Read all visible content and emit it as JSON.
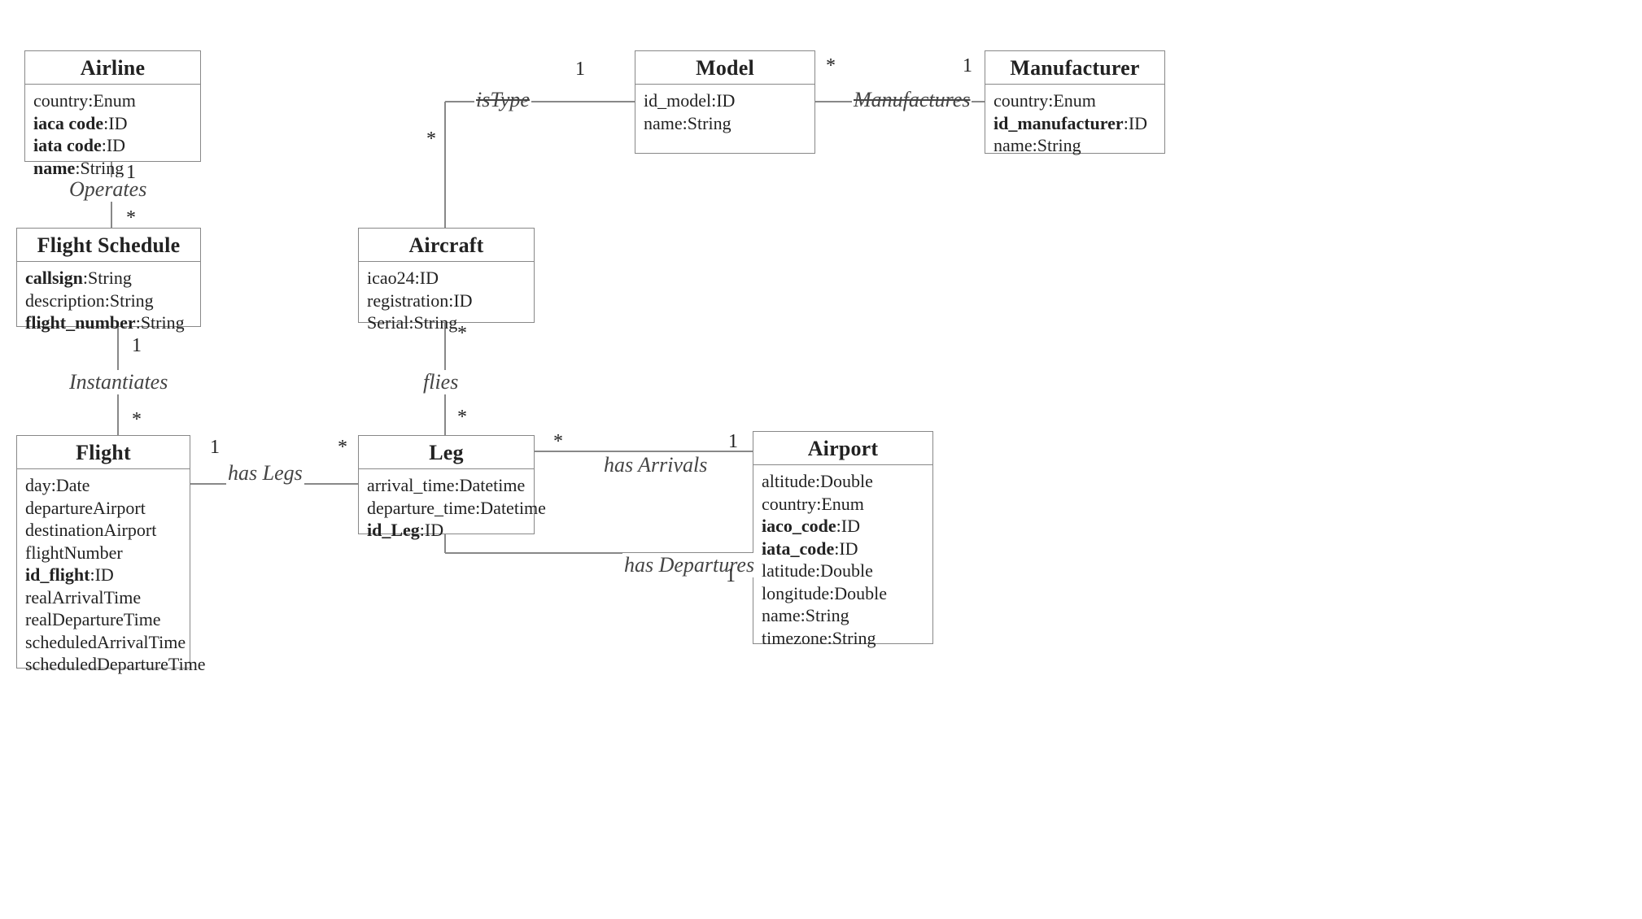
{
  "entities": {
    "airline": {
      "title": "Airline",
      "attrs": [
        {
          "key": "country",
          "type": "Enum",
          "bold": false
        },
        {
          "key": "iaca code",
          "type": "ID",
          "bold": true
        },
        {
          "key": "iata code",
          "type": "ID",
          "bold": true
        },
        {
          "key": "name",
          "type": "String",
          "bold": true
        }
      ]
    },
    "flightSchedule": {
      "title": "Flight Schedule",
      "attrs": [
        {
          "key": "callsign",
          "type": "String",
          "bold": true
        },
        {
          "key": "description",
          "type": "String",
          "bold": false
        },
        {
          "key": "flight_number",
          "type": "String",
          "bold": true
        }
      ]
    },
    "flight": {
      "title": "Flight",
      "attrs": [
        {
          "key": "day",
          "type": "Date",
          "bold": false
        },
        {
          "key": "departureAirport",
          "type": "",
          "bold": false
        },
        {
          "key": "destinationAirport",
          "type": "",
          "bold": false
        },
        {
          "key": "flightNumber",
          "type": "",
          "bold": false
        },
        {
          "key": "id_flight",
          "type": "ID",
          "bold": true
        },
        {
          "key": "realArrivalTime",
          "type": "",
          "bold": false
        },
        {
          "key": "realDepartureTime",
          "type": "",
          "bold": false
        },
        {
          "key": "scheduledArrivalTime",
          "type": "",
          "bold": false
        },
        {
          "key": "scheduledDepartureTime",
          "type": "",
          "bold": false
        }
      ]
    },
    "aircraft": {
      "title": "Aircraft",
      "attrs": [
        {
          "key": "icao24",
          "type": "ID",
          "bold": false
        },
        {
          "key": "registration",
          "type": "ID",
          "bold": false
        },
        {
          "key": "Serial",
          "type": "String",
          "bold": false
        }
      ]
    },
    "leg": {
      "title": "Leg",
      "attrs": [
        {
          "key": "arrival_time",
          "type": "Datetime",
          "bold": false
        },
        {
          "key": "departure_time",
          "type": "Datetime",
          "bold": false
        },
        {
          "key": "id_Leg",
          "type": "ID",
          "bold": true
        }
      ]
    },
    "model": {
      "title": "Model",
      "attrs": [
        {
          "key": "id_model",
          "type": "ID",
          "bold": false
        },
        {
          "key": "name",
          "type": "String",
          "bold": false
        }
      ]
    },
    "manufacturer": {
      "title": "Manufacturer",
      "attrs": [
        {
          "key": "country",
          "type": "Enum",
          "bold": false
        },
        {
          "key": "id_manufacturer",
          "type": "ID",
          "bold": true
        },
        {
          "key": "name",
          "type": "String",
          "bold": false
        }
      ]
    },
    "airport": {
      "title": "Airport",
      "attrs": [
        {
          "key": "altitude",
          "type": "Double",
          "bold": false
        },
        {
          "key": "country",
          "type": "Enum",
          "bold": false
        },
        {
          "key": "iaco_code",
          "type": "ID",
          "bold": true
        },
        {
          "key": "iata_code",
          "type": "ID",
          "bold": true
        },
        {
          "key": "latitude",
          "type": "Double",
          "bold": false
        },
        {
          "key": "longitude",
          "type": "Double",
          "bold": false
        },
        {
          "key": "name",
          "type": "String",
          "bold": false
        },
        {
          "key": "timezone",
          "type": "String",
          "bold": false
        }
      ]
    }
  },
  "relations": {
    "operates": {
      "label": "Operates",
      "m1": "1",
      "m2": "*"
    },
    "instantiates": {
      "label": "Instantiates",
      "m1": "1",
      "m2": "*"
    },
    "hasLegs": {
      "label": "has Legs",
      "m1": "1",
      "m2": "*"
    },
    "flies": {
      "label": "flies",
      "m1": "*",
      "m2": "*"
    },
    "isType": {
      "label": "isType",
      "m1": "*",
      "m2": "1"
    },
    "manufactures": {
      "label": "Manufactures",
      "m1": "*",
      "m2": "1"
    },
    "hasArrivals": {
      "label": "has Arrivals",
      "m1": "*",
      "m2": "1"
    },
    "hasDepartures": {
      "label": "has Departures",
      "m1": "",
      "m2": "1"
    }
  }
}
